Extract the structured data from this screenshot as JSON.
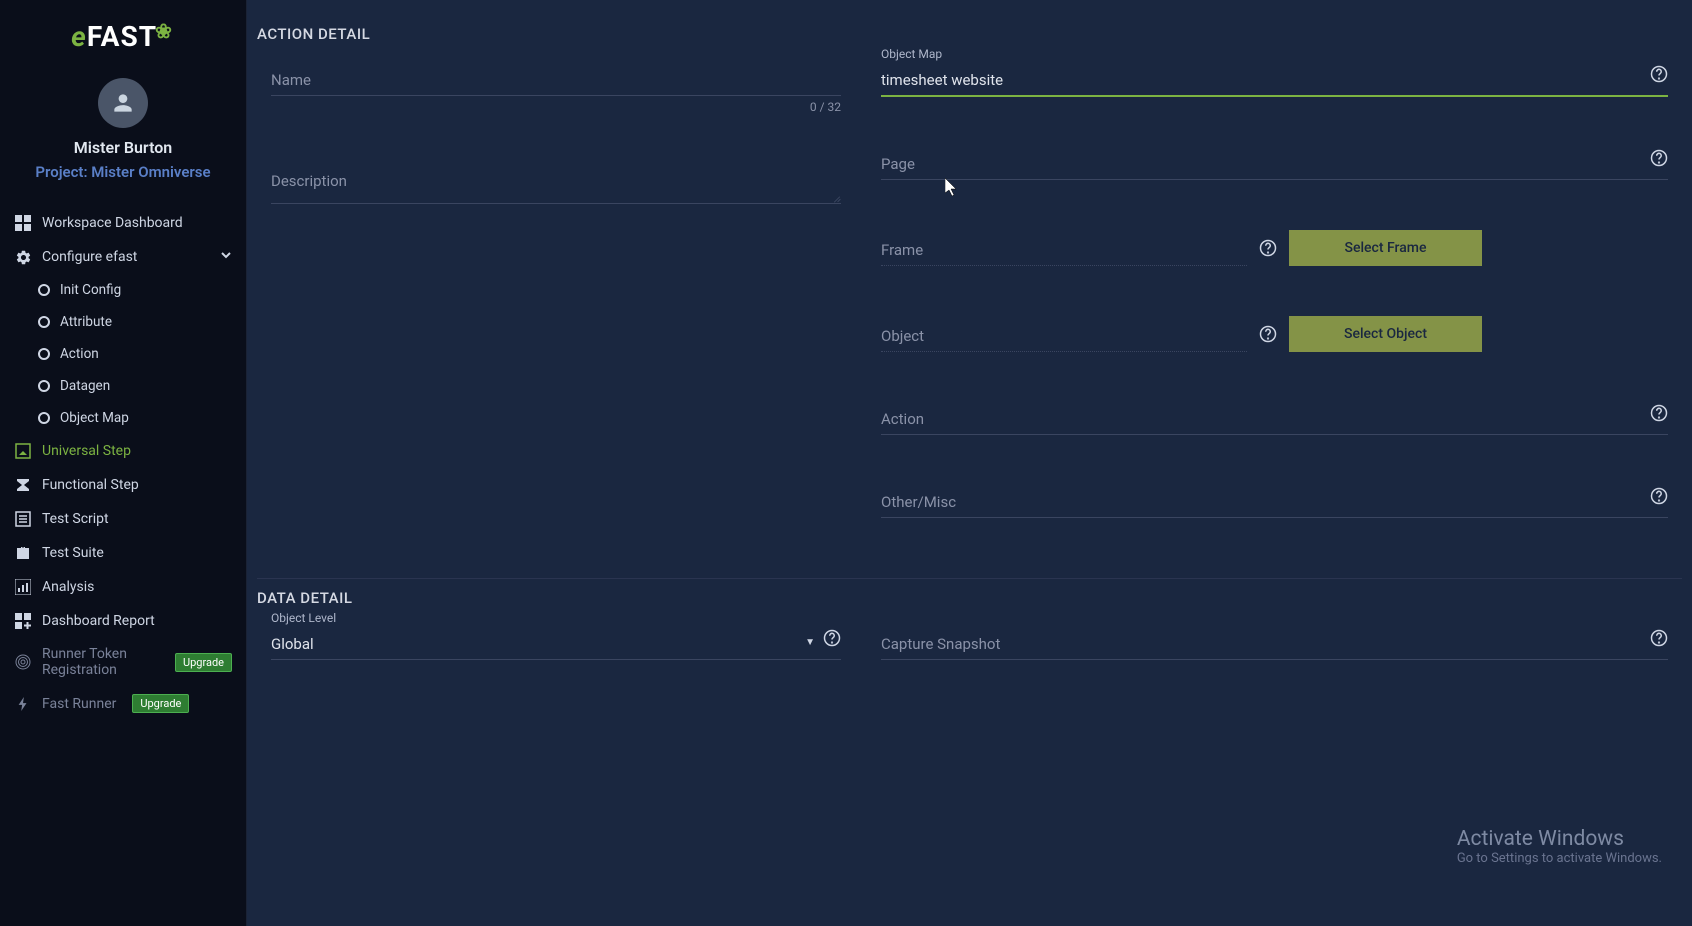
{
  "brand": {
    "prefix": "e",
    "main": "FAST"
  },
  "user": {
    "name": "Mister Burton",
    "project": "Project: Mister Omniverse"
  },
  "nav": {
    "dashboard": "Workspace Dashboard",
    "configure": "Configure efast",
    "sub": {
      "init": "Init Config",
      "attribute": "Attribute",
      "action": "Action",
      "datagen": "Datagen",
      "objectmap": "Object Map"
    },
    "universal": "Universal Step",
    "functional": "Functional Step",
    "testscript": "Test Script",
    "testsuite": "Test Suite",
    "analysis": "Analysis",
    "dashreport": "Dashboard Report",
    "runner_token": "Runner Token Registration",
    "fast_runner": "Fast Runner",
    "upgrade": "Upgrade"
  },
  "section": {
    "action_detail": "ACTION DETAIL",
    "data_detail": "DATA DETAIL"
  },
  "fields": {
    "name": {
      "label": "Name",
      "value": "",
      "counter": "0 / 32"
    },
    "description": {
      "label": "Description",
      "value": ""
    },
    "object_map": {
      "label": "Object Map",
      "value": "timesheet website"
    },
    "page": {
      "label": "Page",
      "value": ""
    },
    "frame": {
      "label": "Frame",
      "value": ""
    },
    "object": {
      "label": "Object",
      "value": ""
    },
    "action": {
      "label": "Action",
      "value": ""
    },
    "other": {
      "label": "Other/Misc",
      "value": ""
    },
    "object_level": {
      "label": "Object Level",
      "value": "Global"
    },
    "capture": {
      "label": "Capture Snapshot",
      "value": ""
    }
  },
  "buttons": {
    "select_frame": "Select Frame",
    "select_object": "Select Object"
  },
  "watermark": {
    "title": "Activate Windows",
    "sub": "Go to Settings to activate Windows."
  }
}
